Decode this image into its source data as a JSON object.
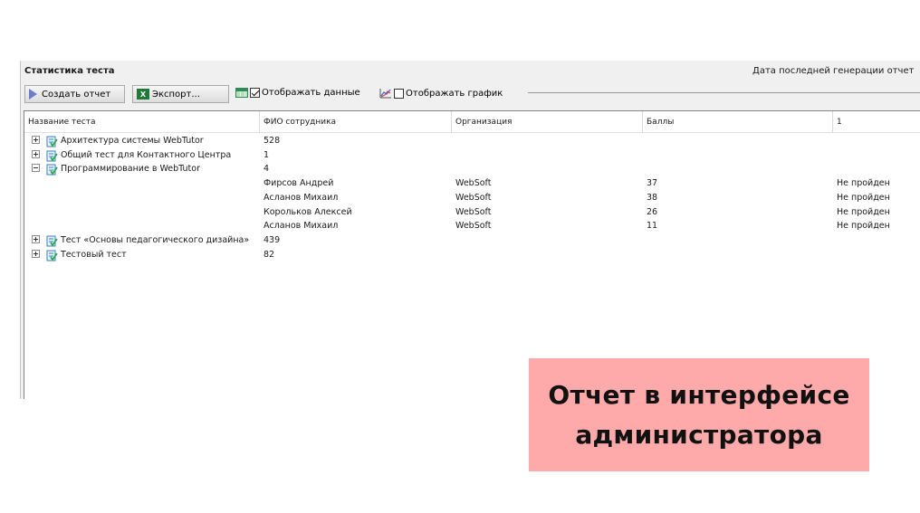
{
  "window": {
    "title": "Статистика теста",
    "generation_label": "Дата последней генерации отчет"
  },
  "toolbar": {
    "create_label": "Создать отчет",
    "export_label": "Экспорт...",
    "show_data_label": "Отображать данные",
    "show_data_checked": true,
    "show_chart_label": "Отображать график",
    "show_chart_checked": false
  },
  "table": {
    "columns": [
      "Название теста",
      "ФИО сотрудника",
      "Организация",
      "Баллы",
      "1"
    ],
    "rows": [
      {
        "name": "Архитектура системы WebTutor",
        "fio": "528",
        "org": "",
        "score": "",
        "status": "",
        "expander": "plus"
      },
      {
        "name": "Общий тест для Контактного Центра",
        "fio": "1",
        "org": "",
        "score": "",
        "status": "",
        "expander": "plus"
      },
      {
        "name": "Программирование в WebTutor",
        "fio": "4",
        "org": "",
        "score": "",
        "status": "",
        "expander": "minus"
      },
      {
        "name": "",
        "fio": "Фирсов Андрей",
        "org": "WebSoft",
        "score": "37",
        "status": "Не пройден",
        "expander": "none"
      },
      {
        "name": "",
        "fio": "Асланов Михаил",
        "org": "WebSoft",
        "score": "38",
        "status": "Не пройден",
        "expander": "none"
      },
      {
        "name": "",
        "fio": "Корольков Алексей",
        "org": "WebSoft",
        "score": "26",
        "status": "Не пройден",
        "expander": "none"
      },
      {
        "name": "",
        "fio": "Асланов Михаил",
        "org": "WebSoft",
        "score": "11",
        "status": "Не пройден",
        "expander": "none"
      },
      {
        "name": "Тест «Основы педагогического дизайна»",
        "fio": "439",
        "org": "",
        "score": "",
        "status": "",
        "expander": "plus"
      },
      {
        "name": "Тестовый тест",
        "fio": "82",
        "org": "",
        "score": "",
        "status": "",
        "expander": "plus"
      }
    ]
  },
  "caption": {
    "line1": "Отчет в интерфейсе",
    "line2": "администратора"
  },
  "colors": {
    "caption_bg": "#ffaaaa",
    "window_bg": "#f0f0f0"
  }
}
